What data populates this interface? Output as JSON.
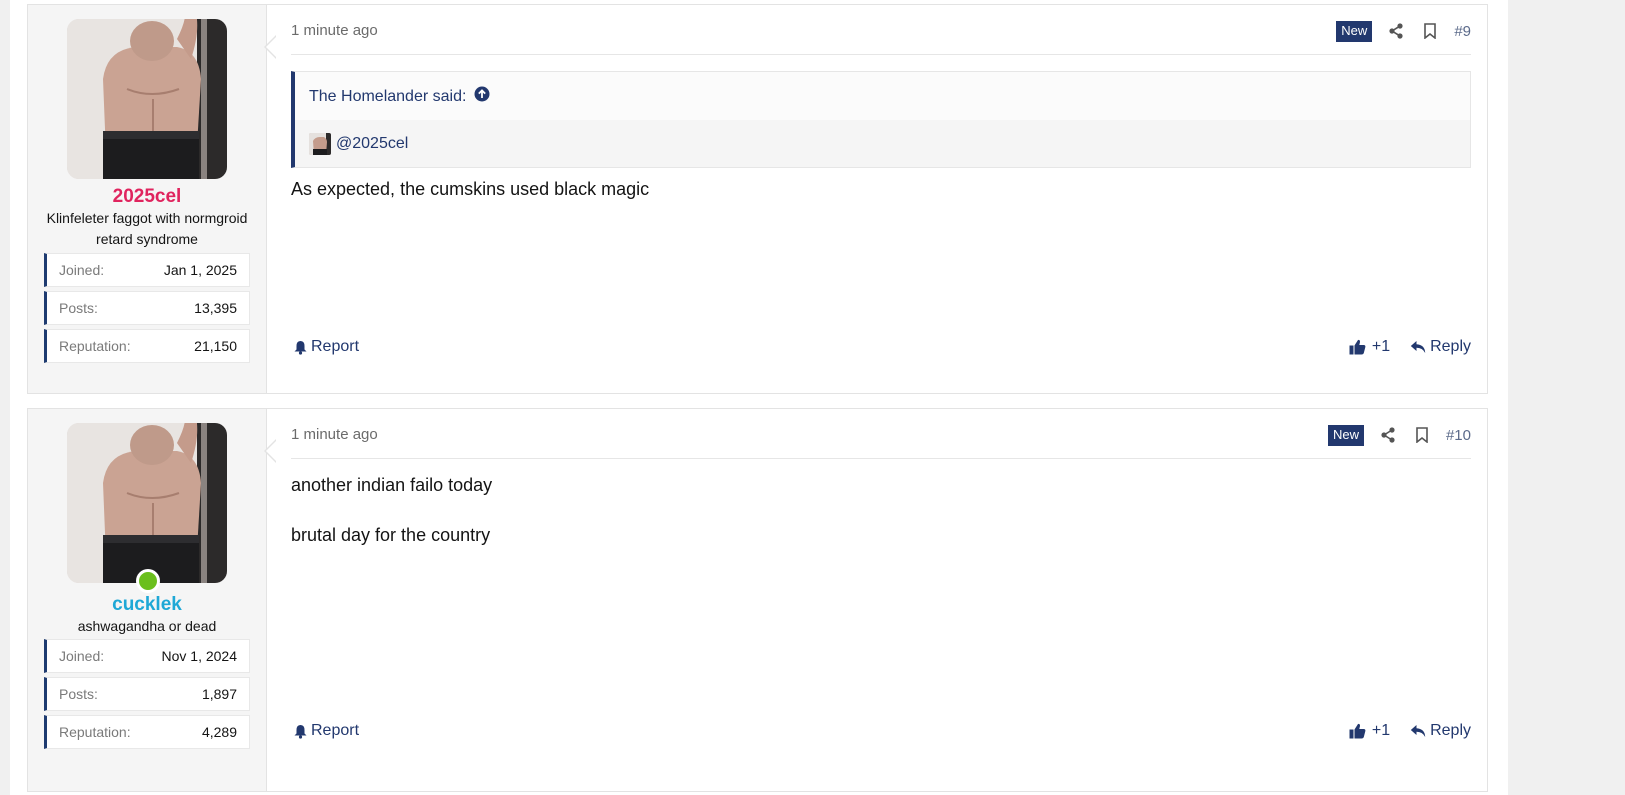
{
  "posts": [
    {
      "username": "2025cel",
      "username_color": "#e0245e",
      "user_title": "Klinfeleter faggot with normgroid retard syndrome",
      "online": false,
      "stats": [
        {
          "label": "Joined:",
          "value": "Jan 1, 2025"
        },
        {
          "label": "Posts:",
          "value": "13,395"
        },
        {
          "label": "Reputation:",
          "value": "21,150"
        }
      ],
      "time": "1 minute ago",
      "badge": "New",
      "post_number": "#9",
      "quote": {
        "author": "The Homelander said:",
        "mention": "@2025cel"
      },
      "body": [
        "As expected, the cumskins used black magic"
      ],
      "report_label": "Report",
      "like_count": "+1",
      "reply_label": "Reply"
    },
    {
      "username": "cucklek",
      "username_color": "#1fa8d6",
      "user_title": "ashwagandha or dead",
      "online": true,
      "stats": [
        {
          "label": "Joined:",
          "value": "Nov 1, 2024"
        },
        {
          "label": "Posts:",
          "value": "1,897"
        },
        {
          "label": "Reputation:",
          "value": "4,289"
        }
      ],
      "time": "1 minute ago",
      "badge": "New",
      "post_number": "#10",
      "body": [
        "another indian failo today",
        "brutal day for the country"
      ],
      "report_label": "Report",
      "like_count": "+1",
      "reply_label": "Reply"
    }
  ],
  "colors": {
    "accent": "#22386e",
    "online": "#6abf1c"
  }
}
